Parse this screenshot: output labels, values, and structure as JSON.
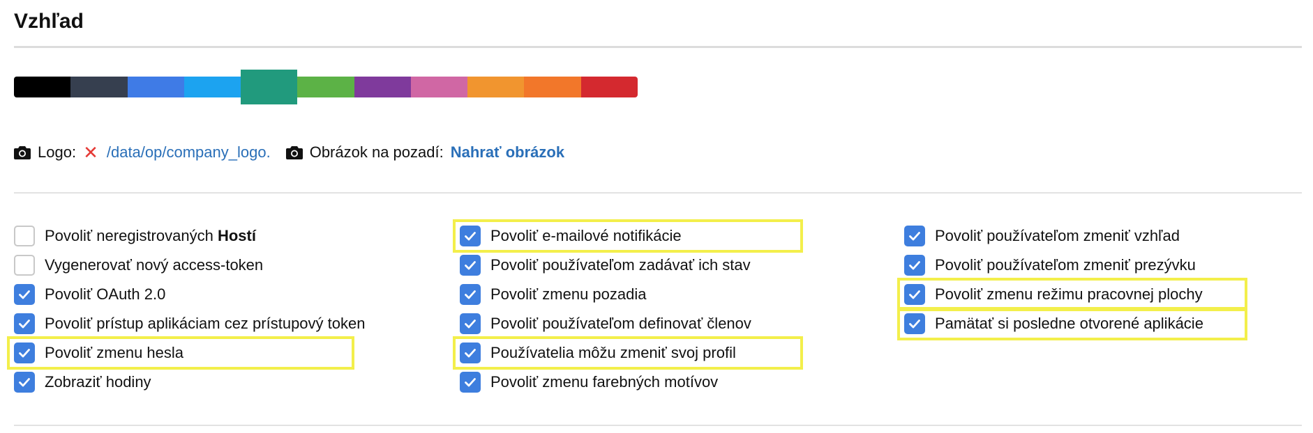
{
  "section": {
    "title": "Vzhľad"
  },
  "palette": {
    "colors": [
      "#000000",
      "#363f4f",
      "#3f7be6",
      "#1ca3f0",
      "#219a7d",
      "#5cb246",
      "#7f3a9c",
      "#d067a4",
      "#f1952f",
      "#f2772a",
      "#d4292f"
    ],
    "selected_index": 4
  },
  "images": {
    "logo_label": "Logo:",
    "logo_remove_icon": "✕",
    "logo_path": "/data/op/company_logo.",
    "background_label": "Obrázok na pozadí:",
    "background_upload": "Nahrať obrázok",
    "icon": "camera-icon"
  },
  "options": {
    "col1": [
      {
        "label": "Povoliť neregistrovaných ",
        "bold": "Hostí",
        "checked": false,
        "highlighted": false
      },
      {
        "label": "Vygenerovať nový access-token",
        "checked": false,
        "highlighted": false
      },
      {
        "label": "Povoliť OAuth 2.0",
        "checked": true,
        "highlighted": false
      },
      {
        "label": "Povoliť prístup aplikáciam cez prístupový token",
        "checked": true,
        "highlighted": false
      },
      {
        "label": "Povoliť zmenu hesla",
        "checked": true,
        "highlighted": true
      },
      {
        "label": "Zobraziť hodiny",
        "checked": true,
        "highlighted": false
      }
    ],
    "col2": [
      {
        "label": "Povoliť e-mailové notifikácie",
        "checked": true,
        "highlighted": true
      },
      {
        "label": "Povoliť používateľom zadávať ich stav",
        "checked": true,
        "highlighted": false
      },
      {
        "label": "Povoliť zmenu pozadia",
        "checked": true,
        "highlighted": false
      },
      {
        "label": "Povoliť používateľom definovať členov",
        "checked": true,
        "highlighted": false
      },
      {
        "label": "Používatelia môžu zmeniť svoj profil",
        "checked": true,
        "highlighted": true
      },
      {
        "label": "Povoliť zmenu farebných motívov",
        "checked": true,
        "highlighted": false
      }
    ],
    "col3": [
      {
        "label": "Povoliť používateľom zmeniť vzhľad",
        "checked": true,
        "highlighted": false
      },
      {
        "label": "Povoliť používateľom zmeniť prezývku",
        "checked": true,
        "highlighted": false
      },
      {
        "label": "Povoliť zmenu režimu pracovnej plochy",
        "checked": true,
        "highlighted": true
      },
      {
        "label": "Pamätať si posledne otvorené aplikácie",
        "checked": true,
        "highlighted": true
      }
    ]
  },
  "colors": {
    "checkbox_on": "#3e7ede",
    "highlight": "#f3ef4b",
    "link": "#2a6fb8",
    "remove": "#e53935"
  }
}
